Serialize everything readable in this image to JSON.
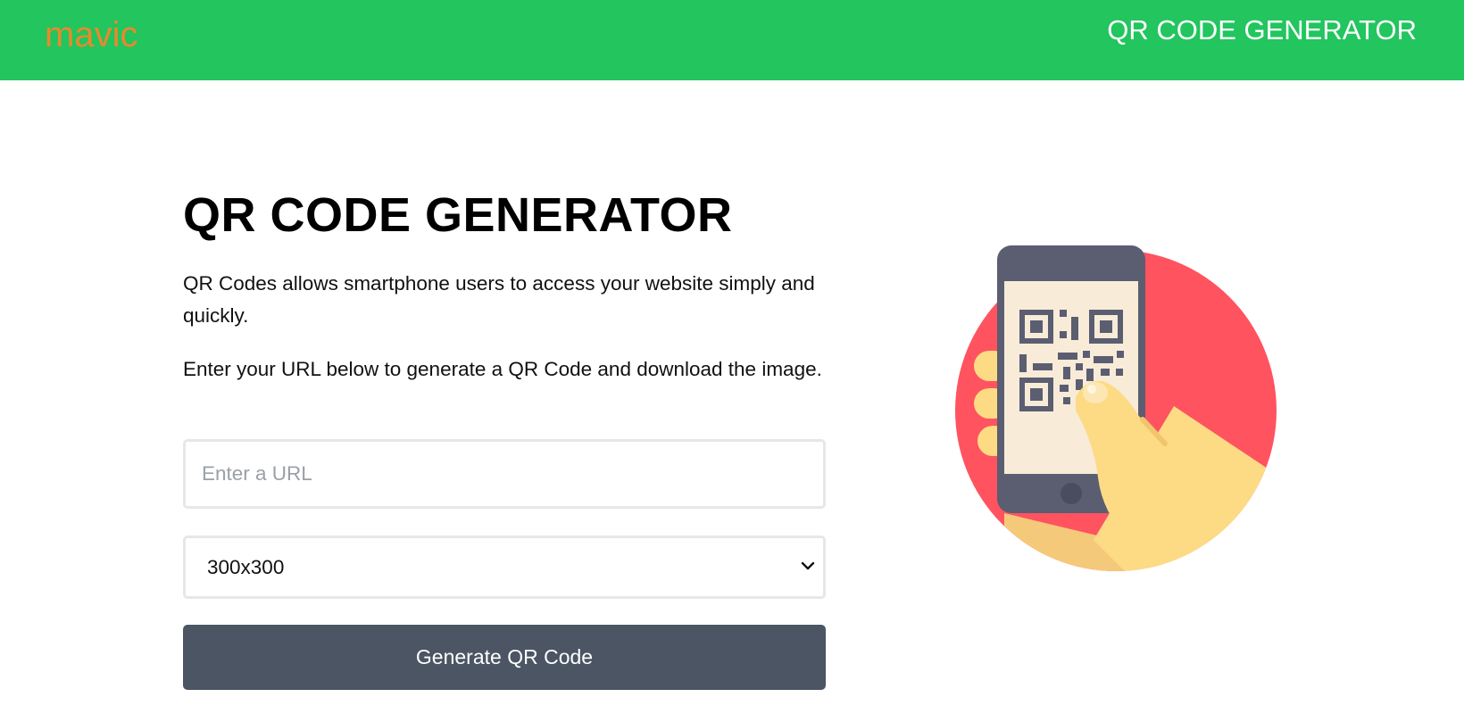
{
  "navbar": {
    "brand": "mavic",
    "title": "QR CODE GENERATOR",
    "bg_color": "#22c55e",
    "brand_color": "#e8892d"
  },
  "main": {
    "title": "QR CODE GENERATOR",
    "description_1": "QR Codes allows smartphone users to access your website simply and quickly.",
    "description_2": "Enter your URL below to generate a QR Code and download the image.",
    "url_input": {
      "value": "",
      "placeholder": "Enter a URL"
    },
    "size_select": {
      "selected": "300x300",
      "icon": "chevron-down-icon"
    },
    "generate_button": {
      "label": "Generate QR Code",
      "color": "#4b5563"
    }
  },
  "illustration": {
    "icon": "phone-scanning-qr-illustration",
    "circle_color": "#ff5360",
    "phone_color": "#5b5d71",
    "screen_color": "#f8ebd8",
    "hand_color": "#fddb84"
  }
}
